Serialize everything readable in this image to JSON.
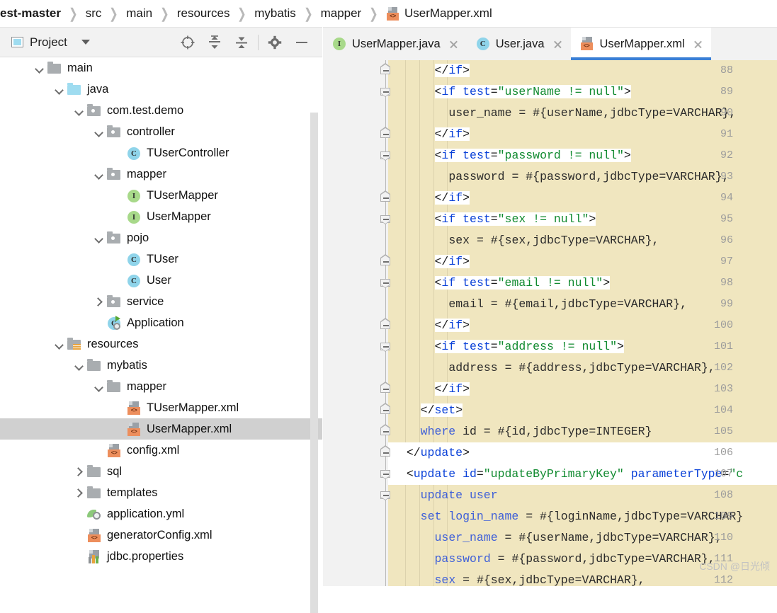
{
  "breadcrumb": {
    "items": [
      "est-master",
      "src",
      "main",
      "resources",
      "mybatis",
      "mapper"
    ],
    "separator": "❯",
    "file": "UserMapper.xml",
    "file_icon": "xml-file-icon"
  },
  "left_panel": {
    "header": {
      "title": "Project",
      "dropdown_icon": "chevron-down-icon",
      "icons": [
        {
          "name": "locate-target-icon",
          "glyph": "target"
        },
        {
          "name": "expand-all-icon",
          "glyph": "expand"
        },
        {
          "name": "collapse-all-icon",
          "glyph": "collapse"
        },
        {
          "name": "settings-gear-icon",
          "glyph": "gear"
        },
        {
          "name": "hide-panel-icon",
          "glyph": "minus"
        }
      ]
    },
    "tree": [
      {
        "label": "main",
        "indent": 2,
        "twisty": "down",
        "icon": "folder-gray",
        "selected": false
      },
      {
        "label": "java",
        "indent": 3,
        "twisty": "down",
        "icon": "folder-blue",
        "selected": false
      },
      {
        "label": "com.test.demo",
        "indent": 4,
        "twisty": "down",
        "icon": "package",
        "selected": false
      },
      {
        "label": "controller",
        "indent": 5,
        "twisty": "down",
        "icon": "package",
        "selected": false
      },
      {
        "label": "TUserController",
        "indent": 6,
        "twisty": "none",
        "icon": "class",
        "selected": false
      },
      {
        "label": "mapper",
        "indent": 5,
        "twisty": "down",
        "icon": "package",
        "selected": false
      },
      {
        "label": "TUserMapper",
        "indent": 6,
        "twisty": "none",
        "icon": "interface",
        "selected": false
      },
      {
        "label": "UserMapper",
        "indent": 6,
        "twisty": "none",
        "icon": "interface",
        "selected": false
      },
      {
        "label": "pojo",
        "indent": 5,
        "twisty": "down",
        "icon": "package",
        "selected": false
      },
      {
        "label": "TUser",
        "indent": 6,
        "twisty": "none",
        "icon": "class",
        "selected": false
      },
      {
        "label": "User",
        "indent": 6,
        "twisty": "none",
        "icon": "class",
        "selected": false
      },
      {
        "label": "service",
        "indent": 5,
        "twisty": "right",
        "icon": "package",
        "selected": false
      },
      {
        "label": "Application",
        "indent": 5,
        "twisty": "none",
        "icon": "application",
        "selected": false
      },
      {
        "label": "resources",
        "indent": 3,
        "twisty": "down",
        "icon": "folder-res",
        "selected": false
      },
      {
        "label": "mybatis",
        "indent": 4,
        "twisty": "down",
        "icon": "folder-gray",
        "selected": false
      },
      {
        "label": "mapper",
        "indent": 5,
        "twisty": "down",
        "icon": "folder-gray",
        "selected": false
      },
      {
        "label": "TUserMapper.xml",
        "indent": 6,
        "twisty": "none",
        "icon": "xml",
        "selected": false
      },
      {
        "label": "UserMapper.xml",
        "indent": 6,
        "twisty": "none",
        "icon": "xml",
        "selected": true
      },
      {
        "label": "config.xml",
        "indent": 5,
        "twisty": "none",
        "icon": "xml",
        "selected": false
      },
      {
        "label": "sql",
        "indent": 4,
        "twisty": "right",
        "icon": "folder-gray",
        "selected": false
      },
      {
        "label": "templates",
        "indent": 4,
        "twisty": "right",
        "icon": "folder-gray",
        "selected": false
      },
      {
        "label": "application.yml",
        "indent": 4,
        "twisty": "none",
        "icon": "yml",
        "selected": false
      },
      {
        "label": "generatorConfig.xml",
        "indent": 4,
        "twisty": "none",
        "icon": "xml",
        "selected": false
      },
      {
        "label": "jdbc.properties",
        "indent": 4,
        "twisty": "none",
        "icon": "properties",
        "selected": false
      }
    ]
  },
  "editor": {
    "tabs": [
      {
        "label": "UserMapper.java",
        "icon": "interface-icon",
        "active": false,
        "close": "close-icon"
      },
      {
        "label": "User.java",
        "icon": "class-icon",
        "active": false,
        "close": "close-icon"
      },
      {
        "label": "UserMapper.xml",
        "icon": "xml-file-icon",
        "active": true,
        "close": "close-icon"
      }
    ],
    "first_line_number": 88,
    "lines": [
      {
        "n": 88,
        "fold": "end",
        "indent": 3,
        "bg": "partial",
        "tokens": [
          {
            "t": "</",
            "c": "tag",
            "w": true
          },
          {
            "t": "if",
            "c": "name",
            "w": true
          },
          {
            "t": ">",
            "c": "tag",
            "w": true
          }
        ]
      },
      {
        "n": 89,
        "fold": "start",
        "indent": 3,
        "bg": "partial",
        "tokens": [
          {
            "t": "<",
            "c": "tag",
            "w": true
          },
          {
            "t": "if",
            "c": "name",
            "w": true
          },
          {
            "t": " ",
            "c": "plain",
            "w": true
          },
          {
            "t": "test",
            "c": "attr",
            "w": true
          },
          {
            "t": "=",
            "c": "tag",
            "w": true
          },
          {
            "t": "\"userName != null\"",
            "c": "val",
            "w": true
          },
          {
            "t": ">",
            "c": "tag",
            "w": true
          }
        ]
      },
      {
        "n": 90,
        "fold": "none",
        "indent": 4,
        "bg": "none",
        "tokens": [
          {
            "t": "user_name = #{userName,jdbcType=VARCHAR},",
            "c": "plain",
            "w": false
          }
        ]
      },
      {
        "n": 91,
        "fold": "end",
        "indent": 3,
        "bg": "partial",
        "tokens": [
          {
            "t": "</",
            "c": "tag",
            "w": true
          },
          {
            "t": "if",
            "c": "name",
            "w": true
          },
          {
            "t": ">",
            "c": "tag",
            "w": true
          }
        ]
      },
      {
        "n": 92,
        "fold": "start",
        "indent": 3,
        "bg": "partial",
        "tokens": [
          {
            "t": "<",
            "c": "tag",
            "w": true
          },
          {
            "t": "if",
            "c": "name",
            "w": true
          },
          {
            "t": " ",
            "c": "plain",
            "w": true
          },
          {
            "t": "test",
            "c": "attr",
            "w": true
          },
          {
            "t": "=",
            "c": "tag",
            "w": true
          },
          {
            "t": "\"password != null\"",
            "c": "val",
            "w": true
          },
          {
            "t": ">",
            "c": "tag",
            "w": true
          }
        ]
      },
      {
        "n": 93,
        "fold": "none",
        "indent": 4,
        "bg": "none",
        "tokens": [
          {
            "t": "password = #{password,jdbcType=VARCHAR},",
            "c": "plain",
            "w": false
          }
        ]
      },
      {
        "n": 94,
        "fold": "end",
        "indent": 3,
        "bg": "partial",
        "tokens": [
          {
            "t": "</",
            "c": "tag",
            "w": true
          },
          {
            "t": "if",
            "c": "name",
            "w": true
          },
          {
            "t": ">",
            "c": "tag",
            "w": true
          }
        ]
      },
      {
        "n": 95,
        "fold": "start",
        "indent": 3,
        "bg": "partial",
        "tokens": [
          {
            "t": "<",
            "c": "tag",
            "w": true
          },
          {
            "t": "if",
            "c": "name",
            "w": true
          },
          {
            "t": " ",
            "c": "plain",
            "w": true
          },
          {
            "t": "test",
            "c": "attr",
            "w": true
          },
          {
            "t": "=",
            "c": "tag",
            "w": true
          },
          {
            "t": "\"sex != null\"",
            "c": "val",
            "w": true
          },
          {
            "t": ">",
            "c": "tag",
            "w": true
          }
        ]
      },
      {
        "n": 96,
        "fold": "none",
        "indent": 4,
        "bg": "none",
        "tokens": [
          {
            "t": "sex = #{sex,jdbcType=VARCHAR},",
            "c": "plain",
            "w": false
          }
        ]
      },
      {
        "n": 97,
        "fold": "end",
        "indent": 3,
        "bg": "partial",
        "tokens": [
          {
            "t": "</",
            "c": "tag",
            "w": true
          },
          {
            "t": "if",
            "c": "name",
            "w": true
          },
          {
            "t": ">",
            "c": "tag",
            "w": true
          }
        ]
      },
      {
        "n": 98,
        "fold": "start",
        "indent": 3,
        "bg": "partial",
        "tokens": [
          {
            "t": "<",
            "c": "tag",
            "w": true
          },
          {
            "t": "if",
            "c": "name",
            "w": true
          },
          {
            "t": " ",
            "c": "plain",
            "w": true
          },
          {
            "t": "test",
            "c": "attr",
            "w": true
          },
          {
            "t": "=",
            "c": "tag",
            "w": true
          },
          {
            "t": "\"email != null\"",
            "c": "val",
            "w": true
          },
          {
            "t": ">",
            "c": "tag",
            "w": true
          }
        ]
      },
      {
        "n": 99,
        "fold": "none",
        "indent": 4,
        "bg": "none",
        "tokens": [
          {
            "t": "email = #{email,jdbcType=VARCHAR},",
            "c": "plain",
            "w": false
          }
        ]
      },
      {
        "n": 100,
        "fold": "end",
        "indent": 3,
        "bg": "partial",
        "tokens": [
          {
            "t": "</",
            "c": "tag",
            "w": true
          },
          {
            "t": "if",
            "c": "name",
            "w": true
          },
          {
            "t": ">",
            "c": "tag",
            "w": true
          }
        ]
      },
      {
        "n": 101,
        "fold": "start",
        "indent": 3,
        "bg": "partial",
        "tokens": [
          {
            "t": "<",
            "c": "tag",
            "w": true
          },
          {
            "t": "if",
            "c": "name",
            "w": true
          },
          {
            "t": " ",
            "c": "plain",
            "w": true
          },
          {
            "t": "test",
            "c": "attr",
            "w": true
          },
          {
            "t": "=",
            "c": "tag",
            "w": true
          },
          {
            "t": "\"address != null\"",
            "c": "val",
            "w": true
          },
          {
            "t": ">",
            "c": "tag",
            "w": true
          }
        ]
      },
      {
        "n": 102,
        "fold": "none",
        "indent": 4,
        "bg": "none",
        "tokens": [
          {
            "t": "address = #{address,jdbcType=VARCHAR},",
            "c": "plain",
            "w": false
          }
        ]
      },
      {
        "n": 103,
        "fold": "end",
        "indent": 3,
        "bg": "partial",
        "tokens": [
          {
            "t": "</",
            "c": "tag",
            "w": true
          },
          {
            "t": "if",
            "c": "name",
            "w": true
          },
          {
            "t": ">",
            "c": "tag",
            "w": true
          }
        ]
      },
      {
        "n": 104,
        "fold": "end",
        "indent": 2,
        "bg": "partial",
        "tokens": [
          {
            "t": "</",
            "c": "tag",
            "w": true
          },
          {
            "t": "set",
            "c": "name",
            "w": true
          },
          {
            "t": ">",
            "c": "tag",
            "w": true
          }
        ]
      },
      {
        "n": 105,
        "fold": "end",
        "indent": 2,
        "bg": "none",
        "tokens": [
          {
            "t": "where",
            "c": "kw",
            "w": false
          },
          {
            "t": " id = #{id,jdbcType=INTEGER}",
            "c": "plain",
            "w": false
          }
        ]
      },
      {
        "n": 106,
        "fold": "end",
        "indent": 1,
        "bg": "full",
        "tokens": [
          {
            "t": "</",
            "c": "tag",
            "w": true
          },
          {
            "t": "update",
            "c": "name",
            "w": true
          },
          {
            "t": ">",
            "c": "tag",
            "w": true
          }
        ]
      },
      {
        "n": 107,
        "fold": "start",
        "indent": 1,
        "bg": "full",
        "tokens": [
          {
            "t": "<",
            "c": "tag",
            "w": true
          },
          {
            "t": "update",
            "c": "name",
            "w": true
          },
          {
            "t": " ",
            "c": "plain",
            "w": true
          },
          {
            "t": "id",
            "c": "attr",
            "w": true
          },
          {
            "t": "=",
            "c": "tag",
            "w": true
          },
          {
            "t": "\"updateByPrimaryKey\"",
            "c": "val",
            "w": true
          },
          {
            "t": " ",
            "c": "plain",
            "w": true
          },
          {
            "t": "parameterType",
            "c": "attr",
            "w": true
          },
          {
            "t": "=",
            "c": "tag",
            "w": true
          },
          {
            "t": "\"c",
            "c": "val",
            "w": true
          }
        ]
      },
      {
        "n": 108,
        "fold": "start",
        "indent": 2,
        "bg": "none",
        "tokens": [
          {
            "t": "update",
            "c": "kw",
            "w": false
          },
          {
            "t": " ",
            "c": "plain",
            "w": false
          },
          {
            "t": "user",
            "c": "kw",
            "w": false
          }
        ]
      },
      {
        "n": 109,
        "fold": "none",
        "indent": 2,
        "bg": "none",
        "tokens": [
          {
            "t": "set",
            "c": "kw",
            "w": false
          },
          {
            "t": " ",
            "c": "plain",
            "w": false
          },
          {
            "t": "login_name",
            "c": "kw",
            "w": false
          },
          {
            "t": " = #{loginName,jdbcType=VARCHAR}",
            "c": "plain",
            "w": false
          }
        ]
      },
      {
        "n": 110,
        "fold": "none",
        "indent": 3,
        "bg": "none",
        "tokens": [
          {
            "t": "user_name",
            "c": "kw",
            "w": false
          },
          {
            "t": " = #{userName,jdbcType=VARCHAR},",
            "c": "plain",
            "w": false
          }
        ]
      },
      {
        "n": 111,
        "fold": "none",
        "indent": 3,
        "bg": "none",
        "tokens": [
          {
            "t": "password",
            "c": "kw",
            "w": false
          },
          {
            "t": " = #{password,jdbcType=VARCHAR},",
            "c": "plain",
            "w": false
          }
        ]
      },
      {
        "n": 112,
        "fold": "none",
        "indent": 3,
        "bg": "none",
        "tokens": [
          {
            "t": "sex",
            "c": "kw",
            "w": false
          },
          {
            "t": " = #{sex,jdbcType=VARCHAR},",
            "c": "plain",
            "w": false
          }
        ]
      }
    ],
    "watermark": "CSDN @日光倾"
  },
  "colors": {
    "editor_bg": "#f0e6bf",
    "tag_highlight_bg": "#ffffff",
    "tag_punct": "#1c1c1c",
    "tag_name": "#0a41d8",
    "attr_value": "#108a2f",
    "sql_keyword": "#3e5fd8",
    "active_tab_underline": "#3a7fd5",
    "selection_bg": "#d0d0d0",
    "xml_icon_badge": "#ed8e5c"
  }
}
